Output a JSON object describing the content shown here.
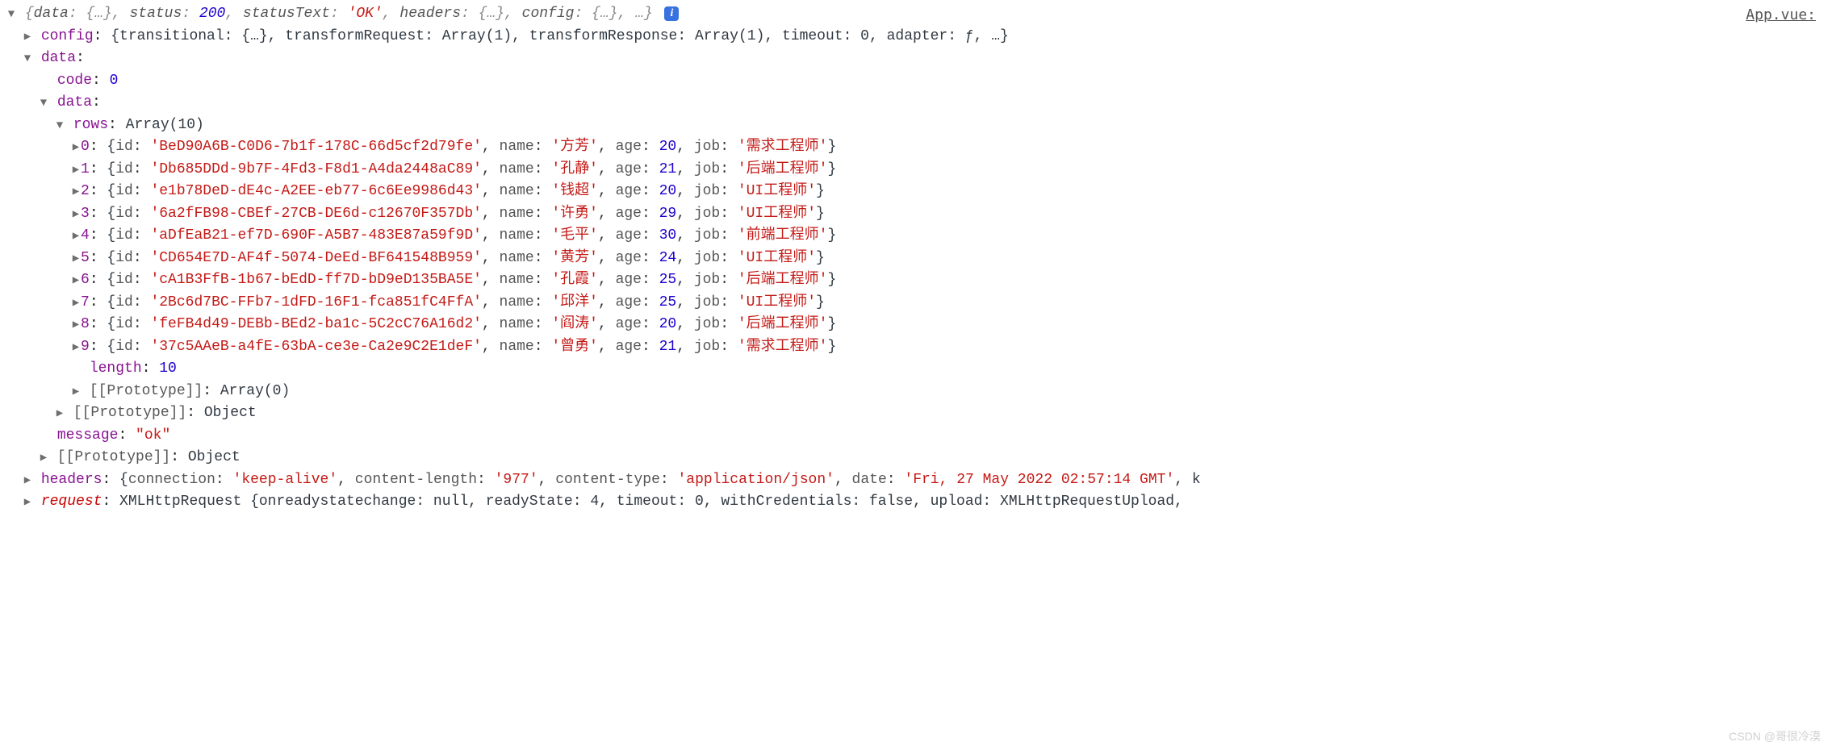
{
  "fileLink": "App.vue:",
  "summary": {
    "status": 200,
    "statusText": "OK"
  },
  "configPreview": "{transitional: {…}, transformRequest: Array(1), transformResponse: Array(1), timeout: 0, adapter: ƒ, …}",
  "dataObj": {
    "code": 0,
    "message": "ok",
    "rowsLabel": "Array(10)",
    "rows": [
      {
        "id": "BeD90A6B-C0D6-7b1f-178C-66d5cf2d79fe",
        "name": "方芳",
        "age": 20,
        "job": "需求工程师"
      },
      {
        "id": "Db685DDd-9b7F-4Fd3-F8d1-A4da2448aC89",
        "name": "孔静",
        "age": 21,
        "job": "后端工程师"
      },
      {
        "id": "e1b78DeD-dE4c-A2EE-eb77-6c6Ee9986d43",
        "name": "钱超",
        "age": 20,
        "job": "UI工程师"
      },
      {
        "id": "6a2fFB98-CBEf-27CB-DE6d-c12670F357Db",
        "name": "许勇",
        "age": 29,
        "job": "UI工程师"
      },
      {
        "id": "aDfEaB21-ef7D-690F-A5B7-483E87a59f9D",
        "name": "毛平",
        "age": 30,
        "job": "前端工程师"
      },
      {
        "id": "CD654E7D-AF4f-5074-DeEd-BF641548B959",
        "name": "黄芳",
        "age": 24,
        "job": "UI工程师"
      },
      {
        "id": "cA1B3FfB-1b67-bEdD-ff7D-bD9eD135BA5E",
        "name": "孔霞",
        "age": 25,
        "job": "后端工程师"
      },
      {
        "id": "2Bc6d7BC-FFb7-1dFD-16F1-fca851fC4FfA",
        "name": "邱洋",
        "age": 25,
        "job": "UI工程师"
      },
      {
        "id": "feFB4d49-DEBb-BEd2-ba1c-5C2cC76A16d2",
        "name": "阎涛",
        "age": 20,
        "job": "后端工程师"
      },
      {
        "id": "37c5AAeB-a4fE-63bA-ce3e-Ca2e9C2E1deF",
        "name": "曾勇",
        "age": 21,
        "job": "需求工程师"
      }
    ],
    "length": 10,
    "rowsProto": "Array(0)",
    "dataProto": "Object",
    "outerProto": "Object"
  },
  "headers": {
    "connection": "keep-alive",
    "contentLength": "977",
    "contentType": "application/json",
    "date": "Fri, 27 May 2022 02:57:14 GMT"
  },
  "requestPreview": "XMLHttpRequest {onreadystatechange: null, readyState: 4, timeout: 0, withCredentials: false, upload: XMLHttpRequestUpload,",
  "labels": {
    "config": "config",
    "data": "data",
    "code": "code",
    "rows": "rows",
    "length": "length",
    "proto": "[[Prototype]]",
    "message": "message",
    "headers": "headers",
    "request": "request",
    "id": "id",
    "name": "name",
    "age": "age",
    "job": "job",
    "connection": "connection",
    "contentLength": "content-length",
    "contentType": "content-type",
    "dateKey": "date",
    "statusKey": "status",
    "statusTextKey": "statusText",
    "headersKey": "headers",
    "configKey": "config",
    "dataKey": "data"
  },
  "watermark": "CSDN @哥很冷漠"
}
